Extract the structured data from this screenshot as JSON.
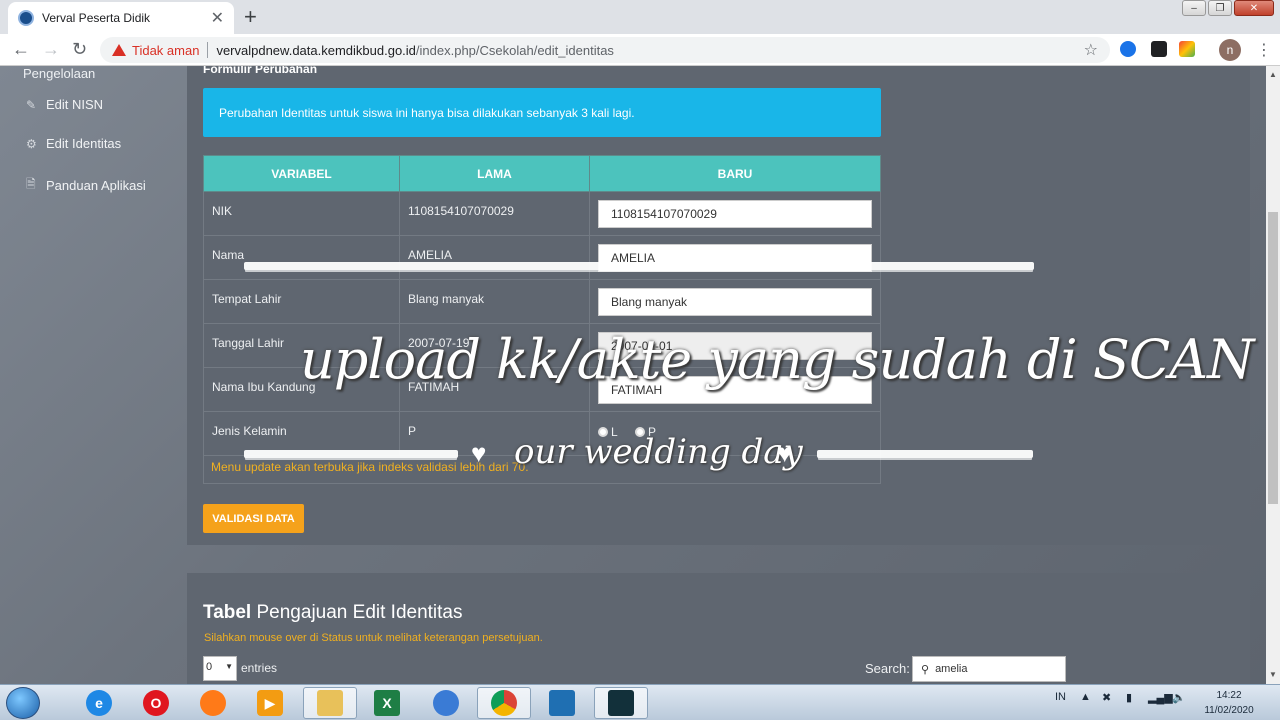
{
  "browser": {
    "tab_title": "Verval Peserta Didik",
    "security_label": "Tidak aman",
    "url_host": "vervalpdnew.data.kemdikbud.go.id",
    "url_path": "/index.php/Csekolah/edit_identitas",
    "avatar_letter": "n"
  },
  "sidebar": {
    "title": "Pengelolaan",
    "items": [
      {
        "label": "Edit NISN",
        "icon": "edit-icon"
      },
      {
        "label": "Edit Identitas",
        "icon": "gear-icon"
      },
      {
        "label": "Panduan Aplikasi",
        "icon": "document-icon"
      }
    ]
  },
  "form": {
    "title": "Formulir Perubahan",
    "alert": "Perubahan Identitas untuk siswa ini hanya bisa dilakukan sebanyak 3 kali lagi.",
    "columns": [
      "VARIABEL",
      "LAMA",
      "BARU"
    ],
    "rows": [
      {
        "variable": "NIK",
        "old": "1108154107070029",
        "new": "1108154107070029"
      },
      {
        "variable": "Nama",
        "old": "AMELIA",
        "new": "AMELIA"
      },
      {
        "variable": "Tempat Lahir",
        "old": "Blang manyak",
        "new": "Blang manyak"
      },
      {
        "variable": "Tanggal Lahir",
        "old": "2007-07-19",
        "new": "2007-07-01"
      },
      {
        "variable": "Nama Ibu Kandung",
        "old": "FATIMAH",
        "new": "FATIMAH"
      },
      {
        "variable": "Jenis Kelamin",
        "old": "P",
        "radio_l": "L",
        "radio_p": "P"
      }
    ],
    "note": "Menu update akan terbuka jika indeks validasi lebih dari 70.",
    "validate_button": "VALIDASI DATA"
  },
  "table2": {
    "title_bold": "Tabel",
    "title_rest": "Pengajuan Edit Identitas",
    "hint": "Silahkan mouse over di Status untuk melihat keterangan persetujuan.",
    "entries_value": "0",
    "entries_label": "entries",
    "search_label": "Search:",
    "search_value": "amelia"
  },
  "overlay": {
    "main_text": "upload kk/akte yang sudah di  SCAN",
    "sub_text": "our wedding day"
  },
  "taskbar": {
    "language": "IN",
    "time": "14:22",
    "date": "11/02/2020"
  },
  "colors": {
    "alert_bg": "#19b6e8",
    "table_header": "#4cc3bd",
    "button_orange": "#f5a21b",
    "warning_red": "#d93025"
  }
}
